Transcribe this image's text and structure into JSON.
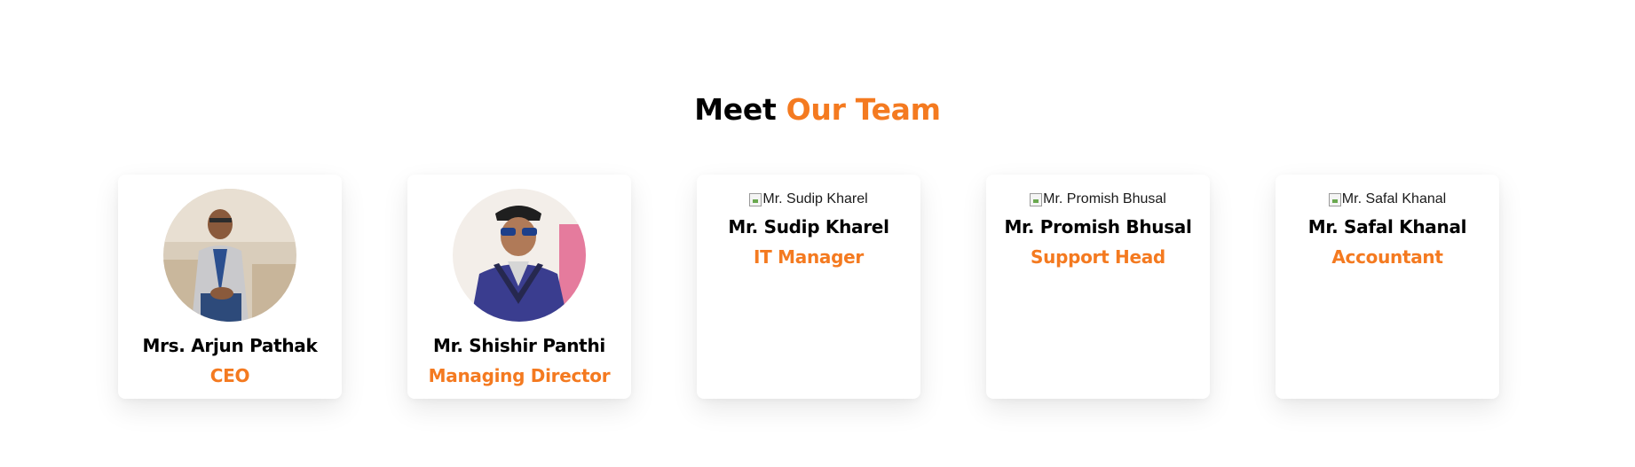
{
  "heading": {
    "part1": "Meet",
    "part2": "Our Team"
  },
  "colors": {
    "accent": "#f47a20",
    "text": "#000000",
    "background": "#ffffff"
  },
  "team": [
    {
      "name": "Mrs. Arjun Pathak",
      "role": "CEO",
      "photo": "loaded",
      "alt": "Mrs. Arjun Pathak"
    },
    {
      "name": "Mr. Shishir Panthi",
      "role": "Managing Director",
      "photo": "loaded",
      "alt": "Mr. Shishir Panthi"
    },
    {
      "name": "Mr. Sudip Kharel",
      "role": "IT Manager",
      "photo": "broken",
      "alt": "Mr. Sudip Kharel"
    },
    {
      "name": "Mr. Promish Bhusal",
      "role": "Support Head",
      "photo": "broken",
      "alt": "Mr. Promish Bhusal"
    },
    {
      "name": "Mr. Safal Khanal",
      "role": "Accountant",
      "photo": "broken",
      "alt": "Mr. Safal Khanal"
    }
  ]
}
